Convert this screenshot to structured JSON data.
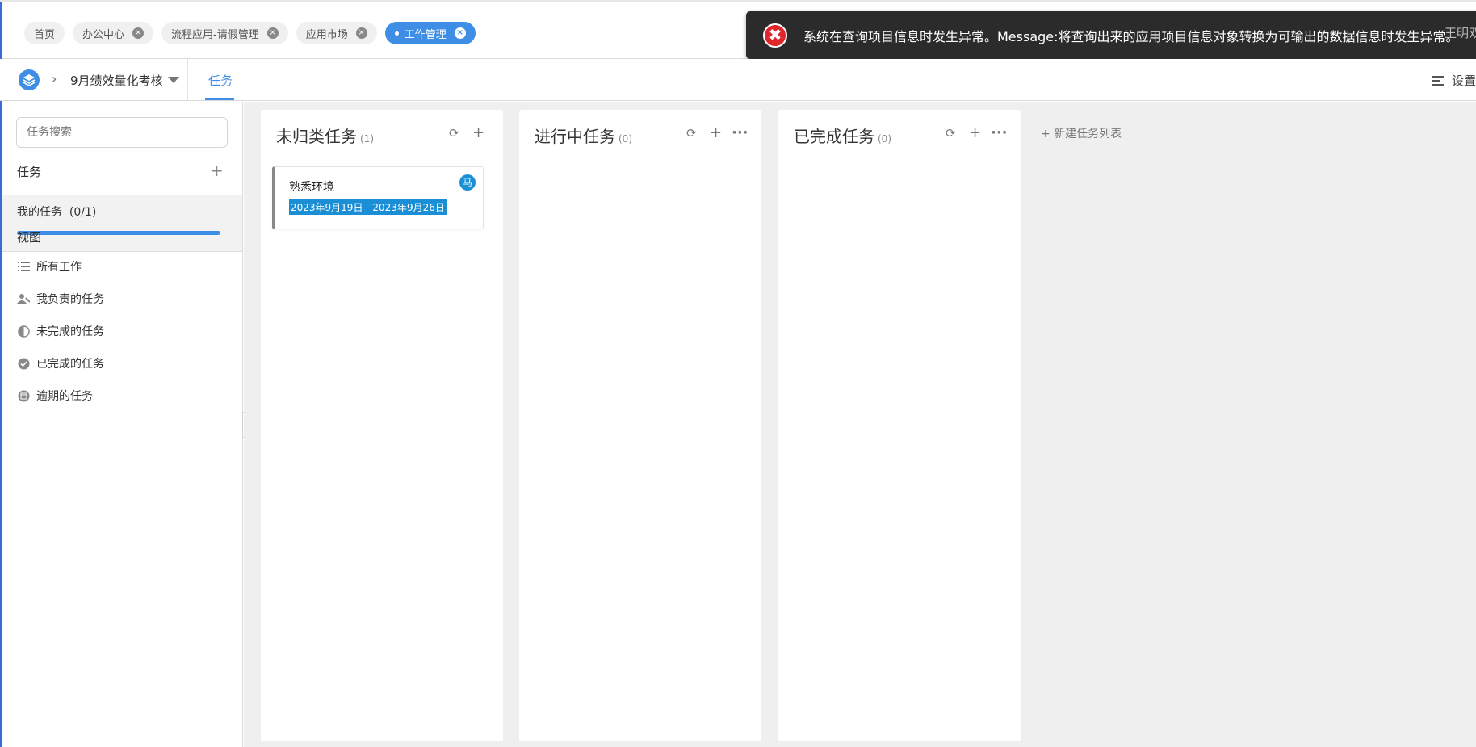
{
  "tabs": [
    {
      "label": "首页",
      "closable": false,
      "active": false
    },
    {
      "label": "办公中心",
      "closable": true,
      "active": false
    },
    {
      "label": "流程应用-请假管理",
      "closable": true,
      "active": false
    },
    {
      "label": "应用市场",
      "closable": true,
      "active": false
    },
    {
      "label": "工作管理",
      "closable": true,
      "active": true
    }
  ],
  "toast": {
    "message": "系统在查询项目信息时发生异常。Message:将查询出来的应用项目信息对象转换为可输出的数据信息时发生异常。",
    "behind_text": "王明双",
    "icon": "error-icon"
  },
  "nav": {
    "project_name": "9月绩效量化考核",
    "active_tab": "任务",
    "settings_label": "设置"
  },
  "sidebar": {
    "search_placeholder": "任务搜索",
    "tasks_header": "任务",
    "my_tasks_label": "我的任务",
    "my_tasks_count": "(0/1)",
    "my_tasks_progress": 1.0,
    "views_header": "视图",
    "views": [
      {
        "label": "所有工作",
        "icon": "list-icon"
      },
      {
        "label": "我负责的任务",
        "icon": "person-icon"
      },
      {
        "label": "未完成的任务",
        "icon": "half-circle-icon"
      },
      {
        "label": "已完成的任务",
        "icon": "check-circle-icon"
      },
      {
        "label": "逾期的任务",
        "icon": "calendar-icon"
      }
    ]
  },
  "board": {
    "columns": [
      {
        "title": "未归类任务",
        "count": "(1)",
        "has_more": false
      },
      {
        "title": "进行中任务",
        "count": "(0)",
        "has_more": true
      },
      {
        "title": "已完成任务",
        "count": "(0)",
        "has_more": true
      }
    ],
    "card": {
      "title": "熟悉环境",
      "date": "2023年9月19日 - 2023年9月26日",
      "assignee": "马"
    },
    "new_list_label": "+ 新建任务列表"
  },
  "collapse_label": "<",
  "colors": {
    "accent": "#3e8ee5",
    "date_highlight": "#1a8fd6",
    "toast_bg": "#2b2b2b",
    "error": "#e0262a"
  }
}
